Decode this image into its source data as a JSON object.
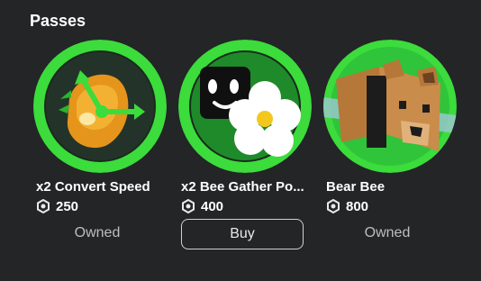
{
  "section": {
    "title": "Passes"
  },
  "passes": [
    {
      "name": "x2 Convert Speed",
      "price": "250",
      "status": "Owned",
      "icon": "honey-convert-icon"
    },
    {
      "name": "x2 Bee Gather Po...",
      "price": "400",
      "action": "Buy",
      "icon": "bee-flower-icon"
    },
    {
      "name": "Bear Bee",
      "price": "800",
      "status": "Owned",
      "icon": "bear-bee-icon"
    }
  ],
  "colors": {
    "background": "#232527",
    "ring_green": "#3bdc3b",
    "muted_text": "#bdbebe"
  }
}
